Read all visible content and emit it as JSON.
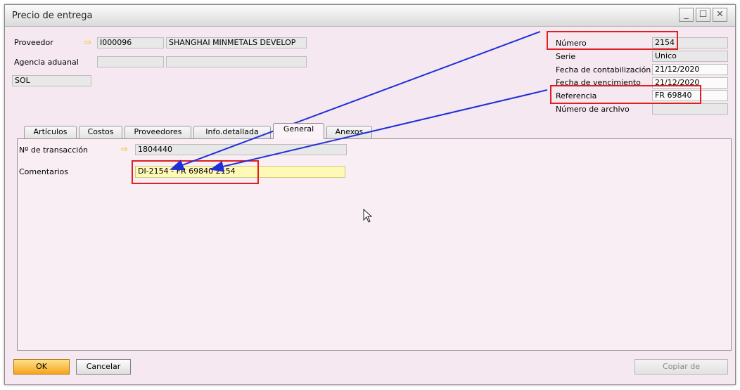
{
  "window": {
    "title": "Precio de entrega"
  },
  "header": {
    "vendor_label": "Proveedor",
    "vendor_code": "I000096",
    "vendor_name": "SHANGHAI MINMETALS DEVELOP",
    "customs_label": "Agencia aduanal",
    "currency_code": "SOL"
  },
  "right_panel": {
    "numero_label": "Número",
    "numero_value": "2154",
    "serie_label": "Serie",
    "serie_value": "Unico",
    "fecha_contab_label": "Fecha de contabilización",
    "fecha_contab_value": "21/12/2020",
    "fecha_venc_label": "Fecha de vencimiento",
    "fecha_venc_value": "21/12/2020",
    "referencia_label": "Referencia",
    "referencia_value": "FR 69840",
    "archivo_label": "Número de archivo",
    "archivo_value": ""
  },
  "tabs": [
    {
      "label": "Artículos"
    },
    {
      "label": "Costos"
    },
    {
      "label": "Proveedores"
    },
    {
      "label": "Info.detallada"
    },
    {
      "label": "General"
    },
    {
      "label": "Anexos"
    }
  ],
  "general": {
    "transaction_label": "Nº de transacción",
    "transaction_value": "1804440",
    "comments_label": "Comentarios",
    "comments_value": "DI-2154 - FR 69840 2154"
  },
  "footer": {
    "ok_label": "OK",
    "cancel_label": "Cancelar",
    "copy_label": "Copiar de"
  },
  "colors": {
    "annotation_red": "#e02020",
    "annotation_blue": "#1f2fd8",
    "link_arrow": "#f0b800"
  },
  "icons": [
    "link-arrow-icon",
    "minimize-icon",
    "maximize-icon",
    "close-icon",
    "mouse-pointer-icon"
  ]
}
